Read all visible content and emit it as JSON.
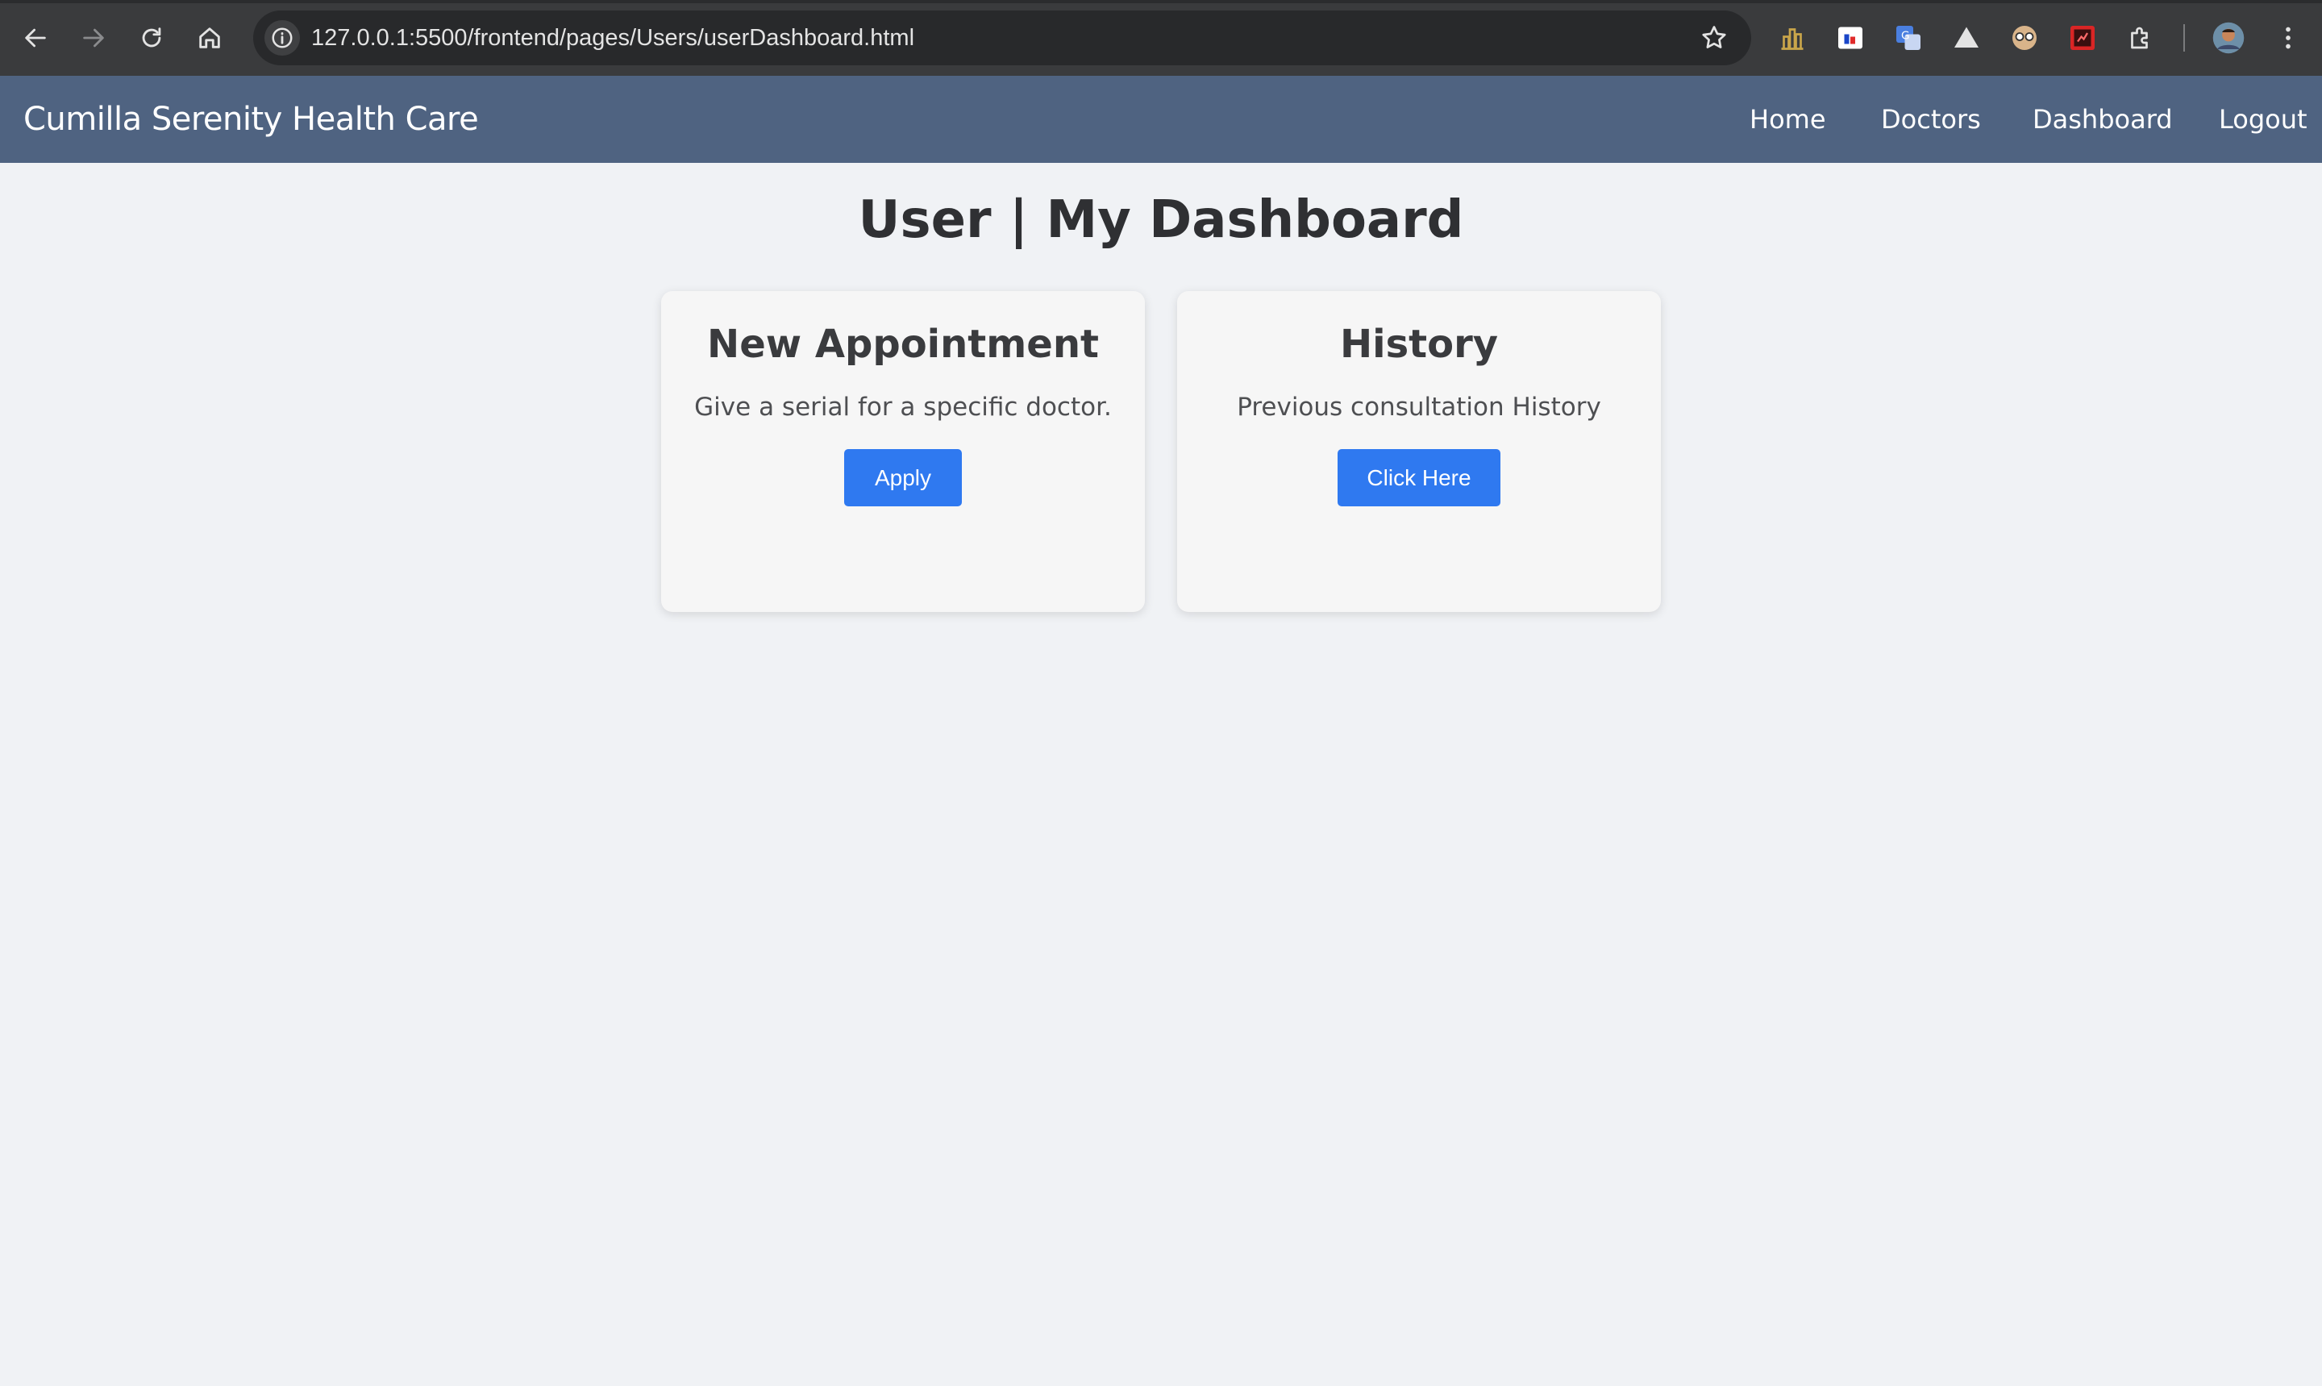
{
  "browser": {
    "url": "127.0.0.1:5500/frontend/pages/Users/userDashboard.html",
    "icons": [
      "back-arrow-icon",
      "forward-arrow-icon",
      "reload-icon",
      "home-icon",
      "site-info-icon",
      "bookmark-star-icon",
      "extension-chart-icon",
      "extension-flag-icon",
      "extension-translate-icon",
      "extension-mountain-icon",
      "extension-glasses-icon",
      "extension-red-square-icon",
      "extensions-puzzle-icon",
      "profile-avatar-icon",
      "more-menu-icon"
    ]
  },
  "navbar": {
    "brand": "Cumilla Serenity Health Care",
    "links": [
      "Home",
      "Doctors",
      "Dashboard",
      "Logout"
    ],
    "background": "#4f6381"
  },
  "main": {
    "title": "User | My Dashboard",
    "cards": [
      {
        "title": "New Appointment",
        "description": "Give a serial for a specific doctor.",
        "button": "Apply"
      },
      {
        "title": "History",
        "description": "Previous consultation History",
        "button": "Click Here"
      }
    ]
  },
  "colors": {
    "accent": "#2f79f0",
    "page_background": "#f0f2f5",
    "card_background": "#f6f6f6"
  }
}
